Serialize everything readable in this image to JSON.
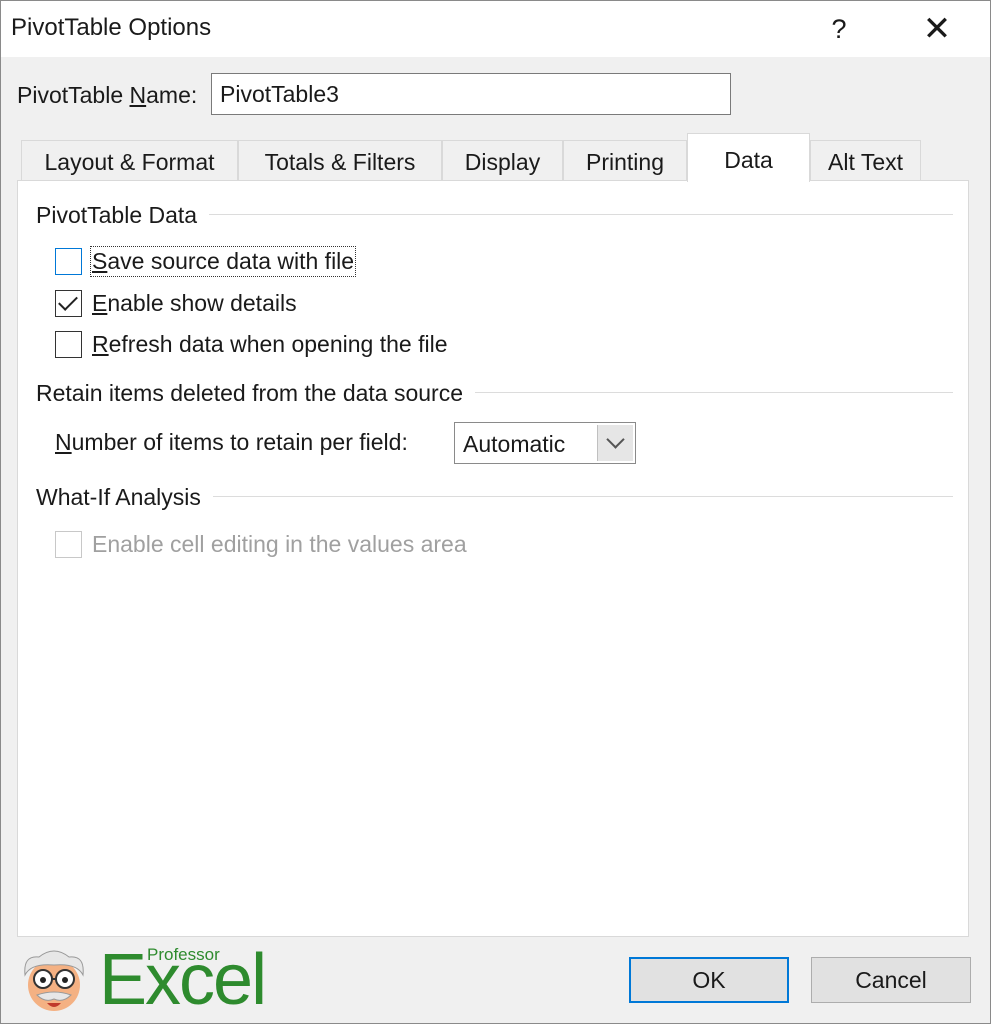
{
  "window": {
    "title": "PivotTable Options",
    "help_glyph": "?",
    "close_glyph": "✕"
  },
  "name_field": {
    "label_pre": "PivotTable ",
    "label_ul": "N",
    "label_post": "ame:",
    "value": "PivotTable3"
  },
  "tabs": [
    {
      "label": "Layout & Format"
    },
    {
      "label": "Totals & Filters"
    },
    {
      "label": "Display"
    },
    {
      "label": "Printing"
    },
    {
      "label": "Data",
      "active": true
    },
    {
      "label": "Alt Text"
    }
  ],
  "pivot_data": {
    "title": "PivotTable Data",
    "save_source": {
      "ul": "S",
      "rest": "ave source data with file",
      "checked": false
    },
    "enable_details": {
      "ul": "E",
      "rest": "nable show details",
      "checked": true
    },
    "refresh_open": {
      "ul": "R",
      "rest": "efresh data when opening the file",
      "checked": false
    }
  },
  "retain": {
    "title": "Retain items deleted from the data source",
    "label_ul": "N",
    "label_rest": "umber of items to retain per field:",
    "value": "Automatic"
  },
  "whatif": {
    "title": "What-If Analysis",
    "cell_editing": {
      "label": "Enable cell editing in the values area",
      "checked": false,
      "disabled": true
    }
  },
  "logo": {
    "small": "Professor",
    "big": "Excel"
  },
  "buttons": {
    "ok": "OK",
    "cancel": "Cancel"
  },
  "colors": {
    "accent": "#0078d7",
    "logo_green": "#2e8b2e"
  }
}
